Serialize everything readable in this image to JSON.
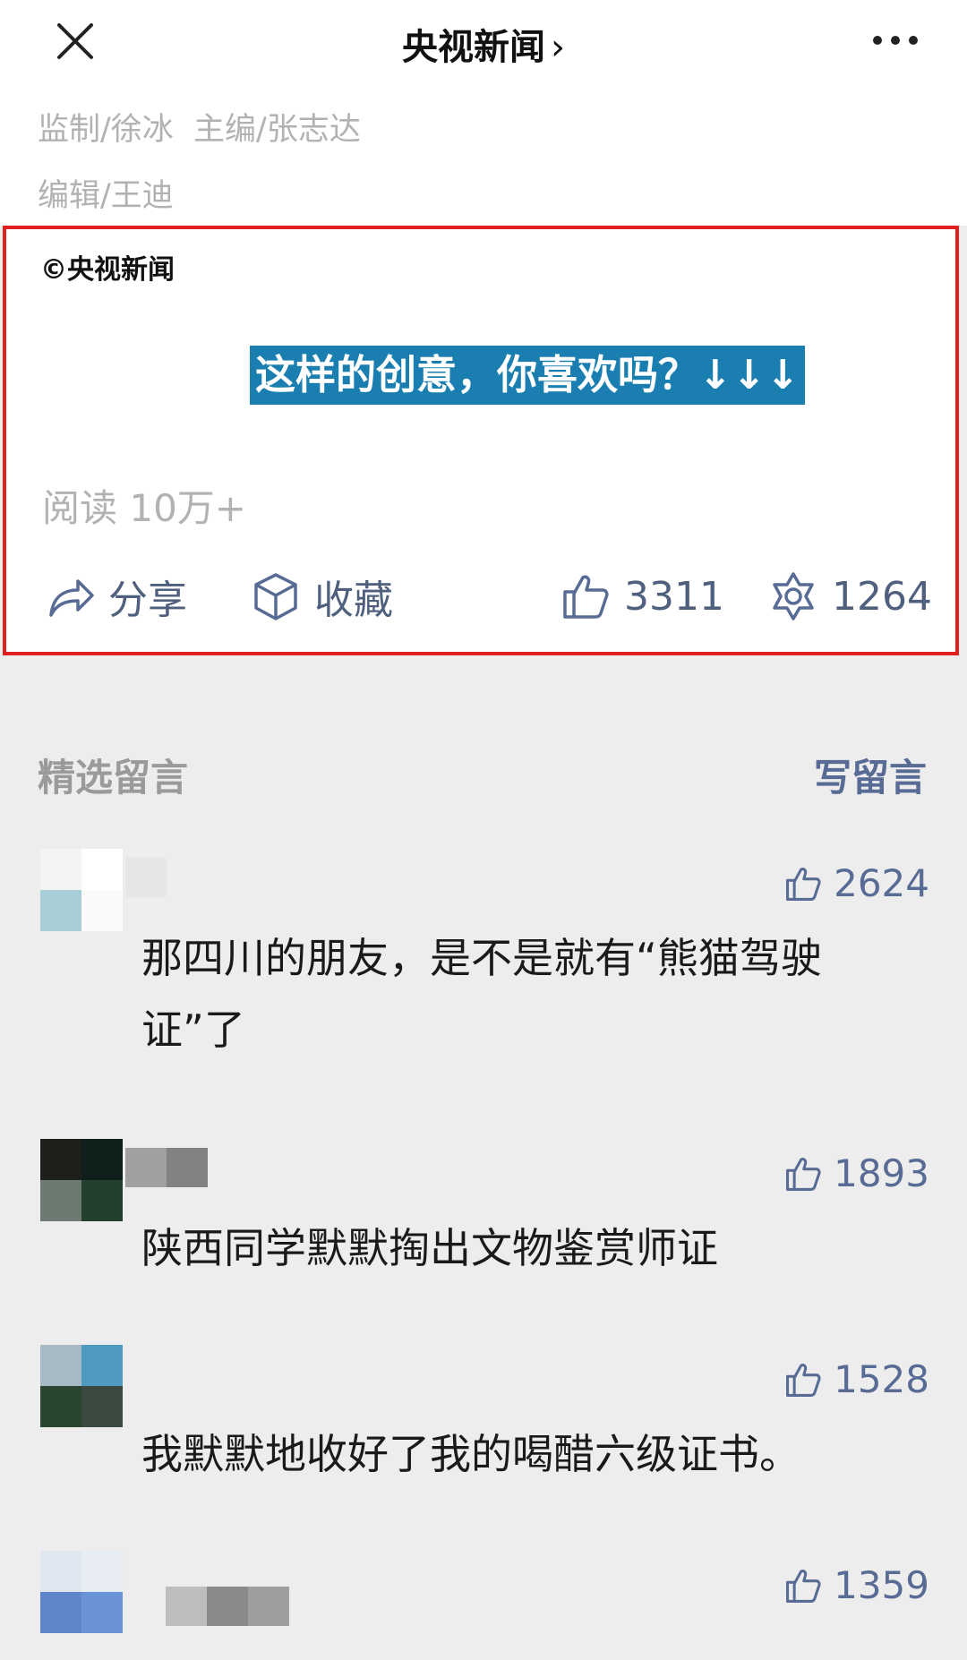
{
  "header": {
    "title": "央视新闻",
    "chevron": "›",
    "close_icon": "close-icon",
    "more_icon": "more-icon"
  },
  "article": {
    "credits_line1": "监制/徐冰  主编/张志达",
    "credits_line2": "编辑/王迪",
    "copyright": "©央视新闻",
    "promo_text": "这样的创意，你喜欢吗？↓↓↓",
    "promo_color": "#1a7fb0",
    "read_count": "阅读 10万+",
    "highlight_color": "#e02020"
  },
  "actions": {
    "share_label": "分享",
    "collect_label": "收藏",
    "like_count": "3311",
    "wow_count": "1264"
  },
  "comments_section": {
    "title": "精选留言",
    "write_label": "写留言",
    "accent_color": "#576b95"
  },
  "comments": [
    {
      "likes": "2624",
      "text": "那四川的朋友，是不是就有“熊猫驾驶证”了"
    },
    {
      "likes": "1893",
      "text": "陕西同学默默掏出文物鉴赏师证"
    },
    {
      "likes": "1528",
      "text": "我默默地收好了我的喝醋六级证书。"
    },
    {
      "likes": "1359",
      "text": ""
    }
  ]
}
